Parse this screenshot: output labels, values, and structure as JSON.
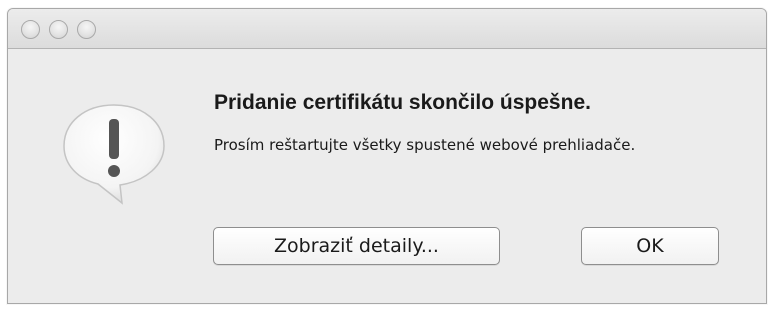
{
  "window": {
    "title": ""
  },
  "dialog": {
    "icon": "exclamation-speech-bubble-icon",
    "heading": "Pridanie certifikátu skončilo úspešne.",
    "message": "Prosím reštartujte všetky spustené webové prehliadače.",
    "buttons": {
      "details_label": "Zobraziť detaily...",
      "ok_label": "OK"
    }
  },
  "colors": {
    "window_background": "#ececec",
    "text": "#1a1a1a",
    "button_border": "#8e8e8e"
  }
}
